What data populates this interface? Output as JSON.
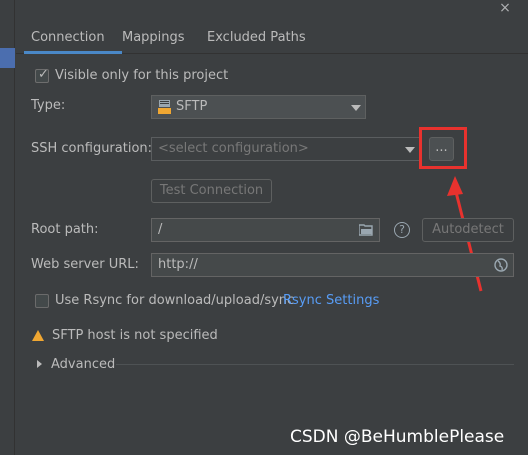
{
  "dialog": {
    "close_symbol": "×"
  },
  "tabs": [
    {
      "label": "Connection"
    },
    {
      "label": "Mappings"
    },
    {
      "label": "Excluded Paths"
    }
  ],
  "connection": {
    "visible_only_label": "Visible only for this project",
    "visible_only_checked": true,
    "type_label": "Type:",
    "type_value": "SFTP",
    "ssh_label": "SSH configuration:",
    "ssh_placeholder": "<select configuration>",
    "more_button": "...",
    "test_button": "Test Connection",
    "root_label": "Root path:",
    "root_value": "/",
    "autodetect_button": "Autodetect",
    "web_url_label": "Web server URL:",
    "web_url_value": "http://",
    "rsync_label": "Use Rsync for download/upload/sync",
    "rsync_checked": false,
    "rsync_link": "Rsync Settings",
    "warning_text": "SFTP host is not specified",
    "advanced_label": "Advanced"
  },
  "annotation": {
    "highlight_color": "#e8322e"
  },
  "watermark": "CSDN @BeHumblePlease"
}
